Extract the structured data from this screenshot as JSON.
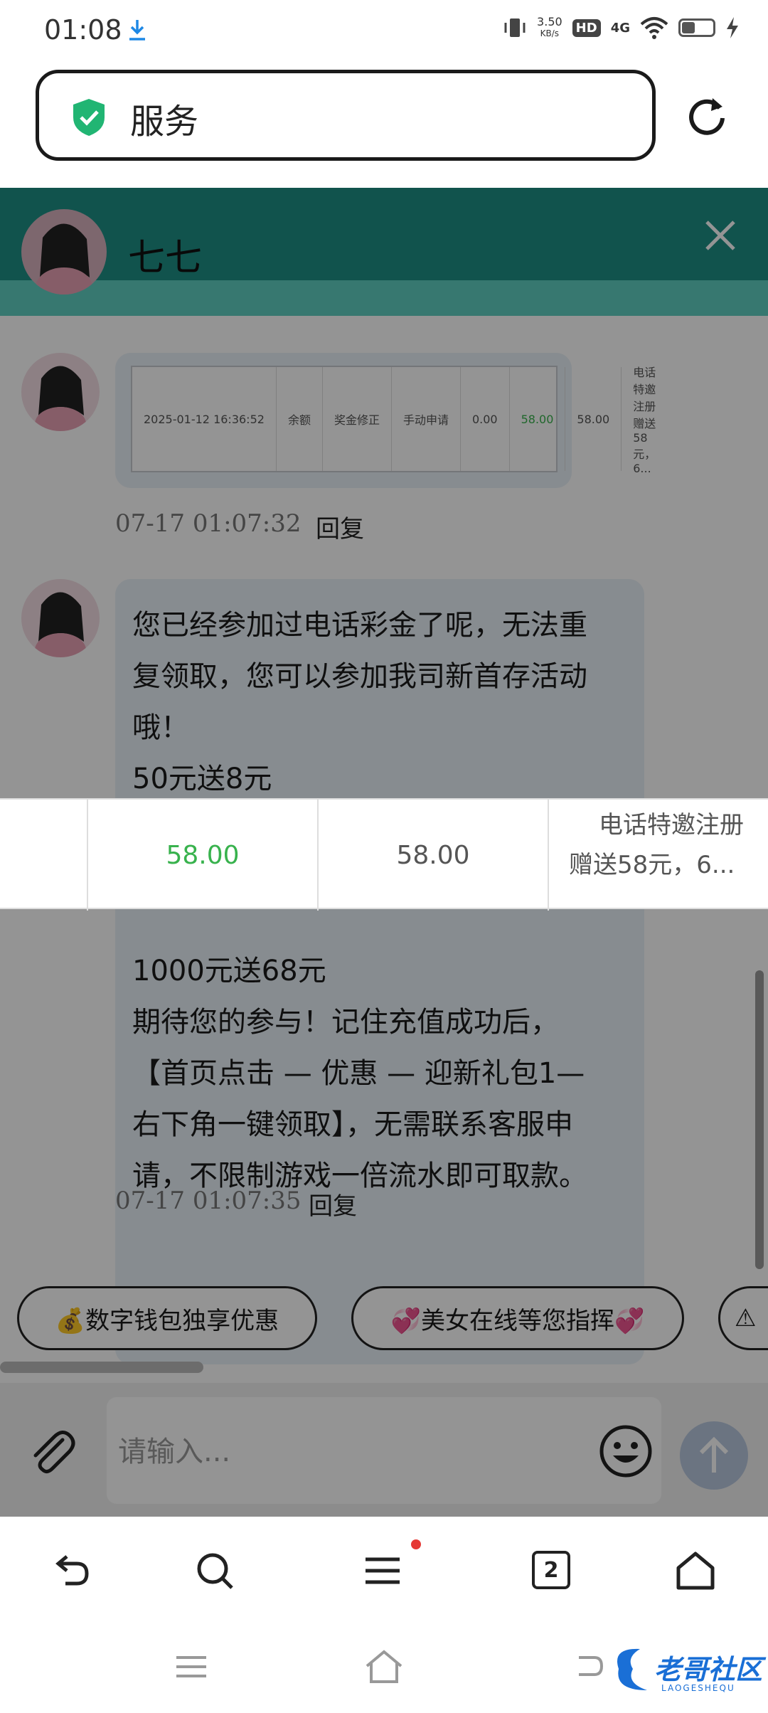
{
  "status_bar": {
    "time": "01:08",
    "net_speed_value": "3.50",
    "net_speed_unit": "KB/s",
    "hd": "HD",
    "network": "4G",
    "icons": [
      "download-icon",
      "vibrate-icon",
      "wifi-icon",
      "battery-icon",
      "charging-icon"
    ]
  },
  "address_bar": {
    "text": "服务",
    "secure_icon": "shield-check-icon"
  },
  "chat": {
    "agent_name": "七七",
    "header_color": "#1e8f86",
    "messages": [
      {
        "type": "image",
        "thumb_cells": [
          "2025-01-12 16:36:52",
          "余额",
          "奖金修正",
          "手动申请",
          "0.00",
          "58.00",
          "58.00",
          "电话特邀注册 赠送58元，6..."
        ],
        "time": "07-17 01:07:32",
        "reply": "回复"
      },
      {
        "type": "text",
        "lines": [
          "您已经参加过电话彩金了呢，无法重",
          "复领取，您可以参加我司新首存活动",
          "哦！",
          "50元送8元",
          "1000元送68元",
          "期待您的参与！记住充值成功后，",
          "【首页点击 — 优惠 — 迎新礼包1—",
          "右下角一键领取】，无需联系客服申",
          "请，不限制游戏一倍流水即可取款。"
        ],
        "time": "07-17 01:07:35",
        "reply": "回复"
      }
    ],
    "quick_chips": [
      "💰数字钱包独享优惠",
      "💞美女在线等您指挥💞",
      "⚠"
    ],
    "input_placeholder": "请输入..."
  },
  "popup_row": {
    "cells": [
      "58.00",
      "58.00",
      "电话特邀注册",
      "赠送58元，6..."
    ],
    "green": "#38b24d"
  },
  "toolbar": {
    "tabs_count": "2"
  },
  "watermark": {
    "text": "老哥社区",
    "sub": "LAOGESHEQU"
  }
}
